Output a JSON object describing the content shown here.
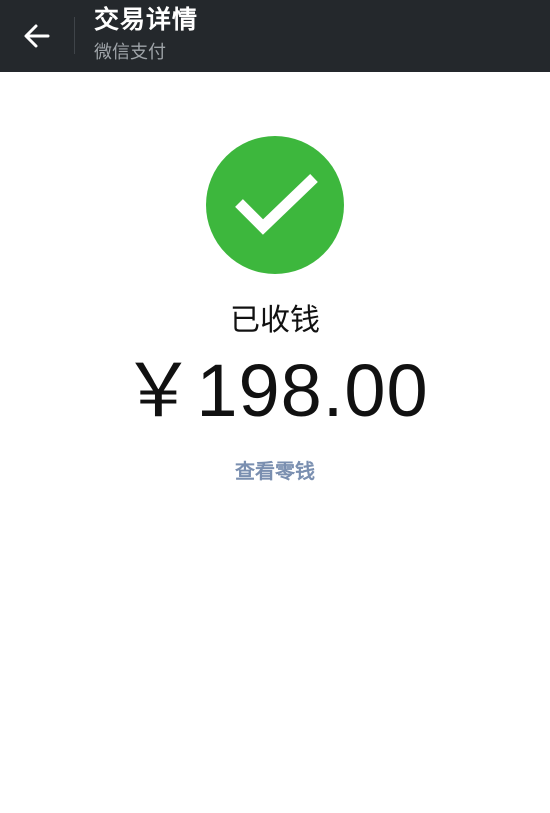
{
  "header": {
    "back_icon": "arrow-left-icon",
    "title": "交易详情",
    "subtitle": "微信支付",
    "background_color": "#24282c"
  },
  "main": {
    "status_icon": "checkmark-icon",
    "status_icon_color": "#3db73d",
    "status_text": "已收钱",
    "amount": "￥198.00",
    "link_text": "查看零钱",
    "link_color": "#7a8fb0"
  }
}
